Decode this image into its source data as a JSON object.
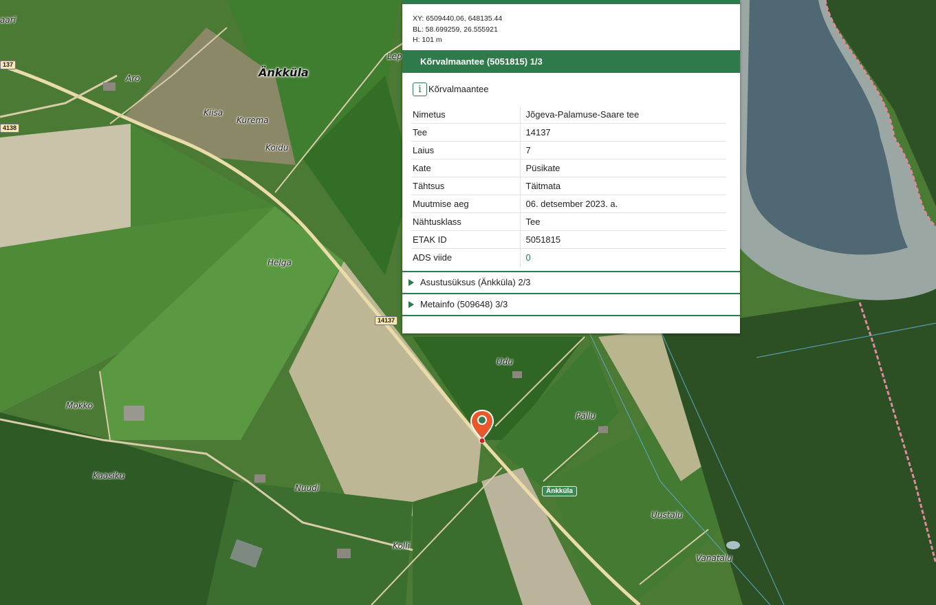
{
  "map": {
    "village": "Änkküla",
    "places": [
      "Aro",
      "Kiisa",
      "Kurema",
      "Koidu",
      "Helga",
      "Mokko",
      "Kaasiku",
      "Nuudi",
      "Kolli",
      "Udu",
      "Pällu",
      "Uustalu",
      "Vanatalu",
      "Lep",
      "aari"
    ],
    "road_shields": [
      "14137",
      "4138",
      "14137",
      "137"
    ],
    "badge": "Änkküla",
    "marker_icon": "map-pin-icon"
  },
  "popup": {
    "coords": {
      "xy": "XY: 6509440.06, 648135.44",
      "bl": "BL: 58.699259, 26.555921",
      "h": "H: 101 m"
    },
    "feature_title": "Kõrvalmaantee (5051815) 1/3",
    "feature_type": "Kõrvalmaantee",
    "attributes": [
      {
        "key": "Nimetus",
        "value": "Jõgeva-Palamuse-Saare tee"
      },
      {
        "key": "Tee",
        "value": "14137"
      },
      {
        "key": "Laius",
        "value": "7"
      },
      {
        "key": "Kate",
        "value": "Püsikate"
      },
      {
        "key": "Tähtsus",
        "value": "Täitmata"
      },
      {
        "key": "Muutmise aeg",
        "value": "06. detsember 2023. a."
      },
      {
        "key": "Nähtusklass",
        "value": "Tee"
      },
      {
        "key": "ETAK ID",
        "value": "5051815"
      },
      {
        "key": "ADS viide",
        "value": "0"
      }
    ],
    "sections": [
      "Asustusüksus (Änkküla) 2/3",
      "Metainfo (509648) 3/3"
    ]
  },
  "colors": {
    "accent": "#2e7a4b",
    "marker": "#e8582a"
  }
}
